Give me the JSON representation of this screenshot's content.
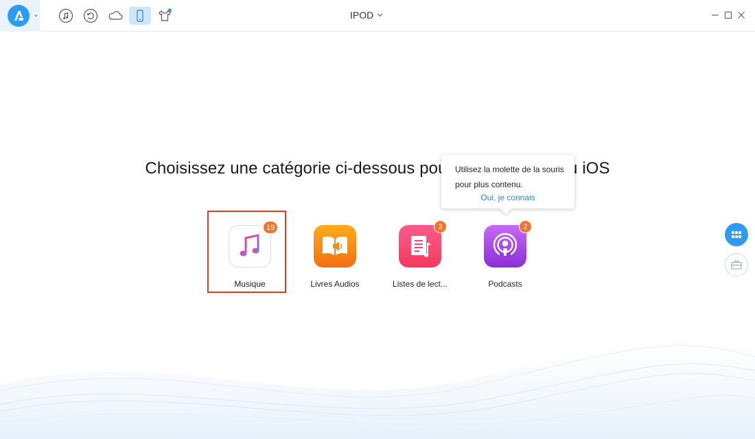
{
  "app": {
    "device_name": "IPOD"
  },
  "toolbar": {
    "icons": [
      "app-logo-icon",
      "music-icon",
      "history-icon",
      "cloud-icon",
      "device-icon",
      "tshirt-icon"
    ],
    "active": "device-icon",
    "accent": "#2d9bf0"
  },
  "main": {
    "headline": "Choisissez une catégorie ci-dessous pour gérer le contenu iOS"
  },
  "categories": [
    {
      "label": "Musique",
      "badge": "19",
      "selected": true,
      "icon": "music-note-icon"
    },
    {
      "label": "Livres Audios",
      "badge": "",
      "selected": false,
      "icon": "audiobook-icon"
    },
    {
      "label": "Listes de lect...",
      "badge": "3",
      "selected": false,
      "icon": "playlist-icon"
    },
    {
      "label": "Podcasts",
      "badge": "2",
      "selected": false,
      "icon": "podcast-icon"
    }
  ],
  "tooltip": {
    "line1": "Utilisez la molette de la souris",
    "line2": "pour plus contenu.",
    "action": "Oui, je connais"
  },
  "colors": {
    "badge": "#f07530",
    "selection": "#e13a1e",
    "link": "#2a86d1"
  }
}
